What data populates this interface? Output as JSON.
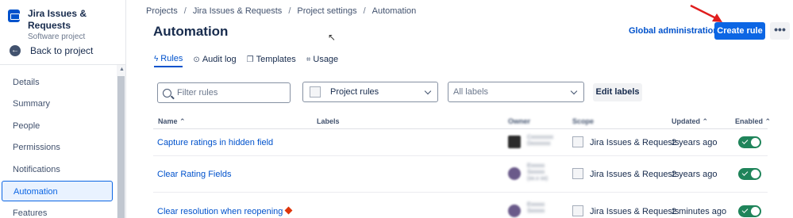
{
  "sidebar": {
    "project_name": "Jira Issues & Requests",
    "project_type": "Software project",
    "back_label": "Back to project",
    "items": [
      {
        "label": "Details"
      },
      {
        "label": "Summary"
      },
      {
        "label": "People"
      },
      {
        "label": "Permissions"
      },
      {
        "label": "Notifications"
      },
      {
        "label": "Automation",
        "active": true
      },
      {
        "label": "Features"
      }
    ]
  },
  "breadcrumb": [
    "Projects",
    "Jira Issues & Requests",
    "Project settings",
    "Automation"
  ],
  "page_title": "Automation",
  "header": {
    "global_admin": "Global administration",
    "create_rule": "Create rule",
    "more": "•••"
  },
  "tabs": [
    {
      "label": "Rules",
      "icon": "lightning-icon",
      "active": true
    },
    {
      "label": "Audit log",
      "icon": "check-circle-icon"
    },
    {
      "label": "Templates",
      "icon": "copy-icon"
    },
    {
      "label": "Usage",
      "icon": "chart-icon"
    }
  ],
  "filters": {
    "search_placeholder": "Filter rules",
    "scope_value": "Project rules",
    "labels_value": "All labels",
    "edit_labels": "Edit labels"
  },
  "table": {
    "headers": {
      "name": "Name",
      "labels": "Labels",
      "owner": "Owner",
      "scope": "Scope",
      "updated": "Updated",
      "enabled": "Enabled"
    },
    "rows": [
      {
        "name": "Capture ratings in hidden field",
        "owner": [
          "Cxxxxxxxx",
          "Dxxxxxxx"
        ],
        "scope": "Jira Issues & Requests",
        "updated": "2 years ago",
        "enabled": true,
        "warning": false
      },
      {
        "name": "Clear Rating Fields",
        "owner": [
          "Exxxxx",
          "Sxxxxx",
          "(xx.x xx)"
        ],
        "scope": "Jira Issues & Requests",
        "updated": "2 years ago",
        "enabled": true,
        "warning": false
      },
      {
        "name": "Clear resolution when reopening",
        "owner": [
          "Exxxxx",
          "Sxxxxx"
        ],
        "scope": "Jira Issues & Requests",
        "updated": "2 minutes ago",
        "enabled": true,
        "warning": true
      }
    ]
  }
}
